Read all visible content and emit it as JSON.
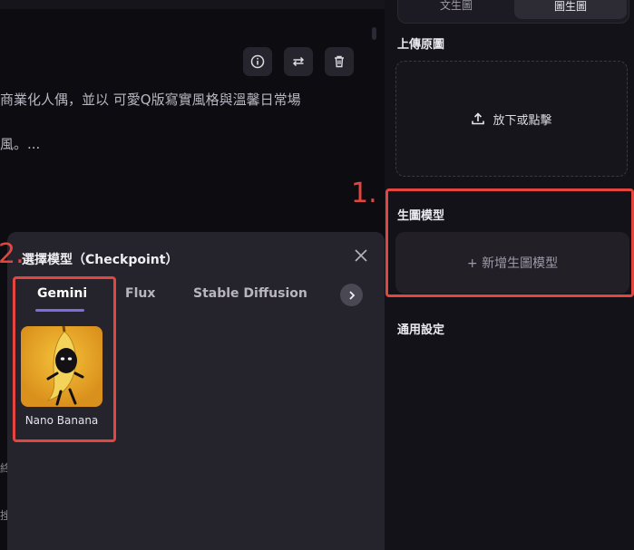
{
  "main": {
    "toolbar": [
      "info-icon",
      "swap-icon",
      "trash-icon"
    ],
    "prompt_lines": [
      "商業化人偶，並以 可愛Q版寫實風格與溫馨日常場",
      "風。..."
    ],
    "edge_chars": [
      "終",
      "挫"
    ]
  },
  "sidebar": {
    "mode_toggle": {
      "left": "文生圖",
      "right": "圖生圖",
      "active": "right"
    },
    "upload_title": "上傳原圖",
    "upload_label": "放下或點擊",
    "model_title": "生圖模型",
    "add_model_label": "+ 新增生圖模型",
    "general_title": "通用設定"
  },
  "modal": {
    "title": "選擇模型（Checkpoint）",
    "tabs": [
      {
        "label": "Gemini",
        "active": true
      },
      {
        "label": "Flux",
        "active": false
      },
      {
        "label": "Stable Diffusion",
        "active": false
      }
    ],
    "models": [
      {
        "name": "Nano Banana"
      }
    ]
  },
  "annotations": {
    "step1": "1.",
    "step2": "2."
  },
  "colors": {
    "accent": "#7d6de0",
    "annotation": "#e2463f",
    "banana_bg": "#e6a92b"
  }
}
